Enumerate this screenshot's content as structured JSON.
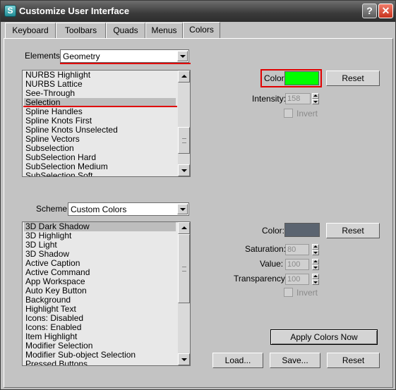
{
  "window": {
    "title": "Customize User Interface",
    "icon_letter": "S",
    "help_label": "?",
    "close_label": "✕"
  },
  "tabs": [
    "Keyboard",
    "Toolbars",
    "Quads",
    "Menus",
    "Colors"
  ],
  "active_tab": "Colors",
  "elements": {
    "label": "Elements:",
    "selected": "Geometry",
    "items": [
      "NURBS Highlight",
      "NURBS Lattice",
      "See-Through",
      "Selection",
      "Spline Handles",
      "Spline Knots First",
      "Spline Knots Unselected",
      "Spline Vectors",
      "Subselection",
      "SubSelection Hard",
      "SubSelection Medium",
      "SubSelection Soft"
    ],
    "selected_item": "Selection"
  },
  "element_color": {
    "color_label": "Color:",
    "color_value": "#00ff00",
    "reset_label": "Reset",
    "intensity_label": "Intensity:",
    "intensity_value": "158",
    "invert_label": "Invert"
  },
  "scheme": {
    "label": "Scheme:",
    "selected": "Custom Colors",
    "items": [
      "3D Dark Shadow",
      "3D Highlight",
      "3D Light",
      "3D Shadow",
      "Active Caption",
      "Active Command",
      "App Workspace",
      "Auto Key Button",
      "Background",
      "Highlight Text",
      "Icons: Disabled",
      "Icons: Enabled",
      "Item Highlight",
      "Modifier Selection",
      "Modifier Sub-object Selection",
      "Pressed Buttons"
    ],
    "selected_item": "3D Dark Shadow"
  },
  "scheme_color": {
    "color_label": "Color:",
    "color_value": "#5b6470",
    "reset_label": "Reset",
    "saturation_label": "Saturation:",
    "saturation_value": "80",
    "value_label": "Value:",
    "value_value": "100",
    "transparency_label": "Transparency:",
    "transparency_value": "100",
    "invert_label": "Invert"
  },
  "actions": {
    "apply_label": "Apply Colors Now",
    "load_label": "Load...",
    "save_label": "Save...",
    "reset_label": "Reset"
  },
  "highlight_color": "#e00000"
}
